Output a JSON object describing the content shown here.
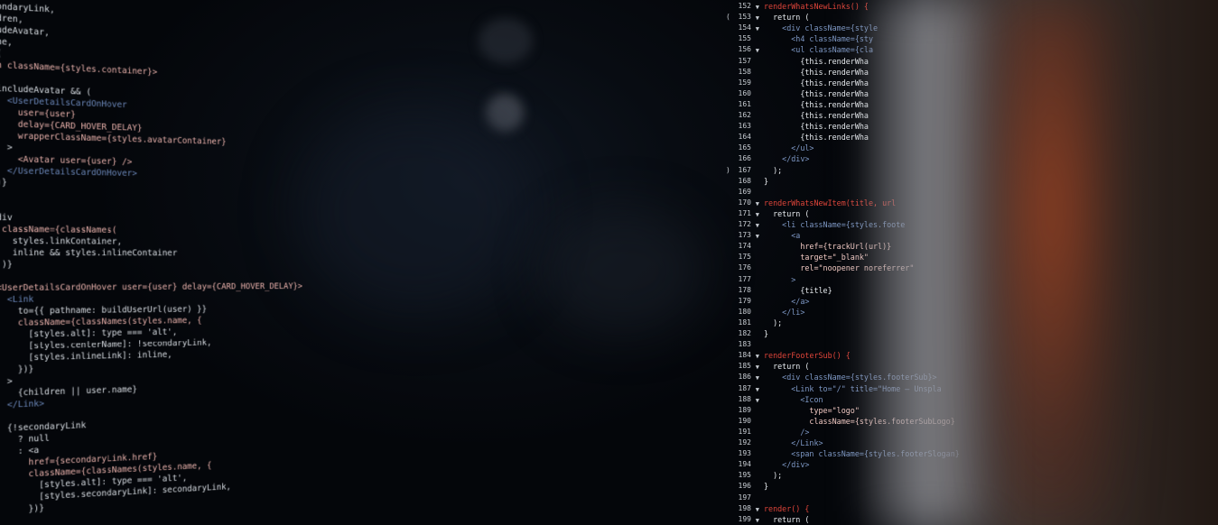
{
  "left_code": [
    {
      "t": "ondaryLink,"
    },
    {
      "t": "dren,"
    },
    {
      "t": "udeAvatar,"
    },
    {
      "t": "ne,"
    },
    {
      "t": "("
    },
    {
      "t": "n className={styles.container}>"
    },
    {
      "t": ""
    },
    {
      "t": "includeAvatar && ("
    },
    {
      "t": "  <UserDetailsCardOnHover"
    },
    {
      "t": "    user={user}"
    },
    {
      "t": "    delay={CARD_HOVER_DELAY}"
    },
    {
      "t": "    wrapperClassName={styles.avatarContainer}"
    },
    {
      "t": "  >"
    },
    {
      "t": "    <Avatar user={user} />"
    },
    {
      "t": "  </UserDetailsCardOnHover>"
    },
    {
      "t": ")}"
    },
    {
      "t": ""
    },
    {
      "t": ""
    },
    {
      "t": "div"
    },
    {
      "t": " className={classNames("
    },
    {
      "t": "   styles.linkContainer,"
    },
    {
      "t": "   inline && styles.inlineContainer"
    },
    {
      "t": " )}"
    },
    {
      "t": ""
    },
    {
      "t": "<UserDetailsCardOnHover user={user} delay={CARD_HOVER_DELAY}>"
    },
    {
      "t": "  <Link"
    },
    {
      "t": "    to={{ pathname: buildUserUrl(user) }}"
    },
    {
      "t": "    className={classNames(styles.name, {"
    },
    {
      "t": "      [styles.alt]: type === 'alt',"
    },
    {
      "t": "      [styles.centerName]: !secondaryLink,"
    },
    {
      "t": "      [styles.inlineLink]: inline,"
    },
    {
      "t": "    })}"
    },
    {
      "t": "  >"
    },
    {
      "t": "    {children || user.name}"
    },
    {
      "t": "  </Link>"
    },
    {
      "t": ""
    },
    {
      "t": "  {!secondaryLink"
    },
    {
      "t": "    ? null"
    },
    {
      "t": "    : <a"
    },
    {
      "t": "      href={secondaryLink.href}"
    },
    {
      "t": "      className={classNames(styles.name, {"
    },
    {
      "t": "        [styles.alt]: type === 'alt',"
    },
    {
      "t": "        [styles.secondaryLink]: secondaryLink,"
    },
    {
      "t": "      })}"
    }
  ],
  "right_gutter": [
    {
      "n": "152",
      "a": "▼"
    },
    {
      "n": "153",
      "a": "▼",
      "pre": "("
    },
    {
      "n": "154",
      "a": "▼"
    },
    {
      "n": "155",
      "a": ""
    },
    {
      "n": "156",
      "a": "▼"
    },
    {
      "n": "157",
      "a": ""
    },
    {
      "n": "158",
      "a": ""
    },
    {
      "n": "159",
      "a": ""
    },
    {
      "n": "160",
      "a": ""
    },
    {
      "n": "161",
      "a": ""
    },
    {
      "n": "162",
      "a": ""
    },
    {
      "n": "163",
      "a": ""
    },
    {
      "n": "164",
      "a": ""
    },
    {
      "n": "165",
      "a": ""
    },
    {
      "n": "166",
      "a": ""
    },
    {
      "n": "167",
      "a": "",
      "pre": ")"
    },
    {
      "n": "168",
      "a": ""
    },
    {
      "n": "169",
      "a": ""
    },
    {
      "n": "170",
      "a": "▼"
    },
    {
      "n": "171",
      "a": "▼"
    },
    {
      "n": "172",
      "a": "▼"
    },
    {
      "n": "173",
      "a": "▼"
    },
    {
      "n": "174",
      "a": ""
    },
    {
      "n": "175",
      "a": ""
    },
    {
      "n": "176",
      "a": ""
    },
    {
      "n": "177",
      "a": ""
    },
    {
      "n": "178",
      "a": ""
    },
    {
      "n": "179",
      "a": ""
    },
    {
      "n": "180",
      "a": ""
    },
    {
      "n": "181",
      "a": ""
    },
    {
      "n": "182",
      "a": ""
    },
    {
      "n": "183",
      "a": ""
    },
    {
      "n": "184",
      "a": "▼"
    },
    {
      "n": "185",
      "a": "▼"
    },
    {
      "n": "186",
      "a": "▼"
    },
    {
      "n": "187",
      "a": "▼"
    },
    {
      "n": "188",
      "a": "▼"
    },
    {
      "n": "189",
      "a": ""
    },
    {
      "n": "190",
      "a": ""
    },
    {
      "n": "191",
      "a": ""
    },
    {
      "n": "192",
      "a": ""
    },
    {
      "n": "193",
      "a": ""
    },
    {
      "n": "194",
      "a": ""
    },
    {
      "n": "195",
      "a": ""
    },
    {
      "n": "196",
      "a": ""
    },
    {
      "n": "197",
      "a": ""
    },
    {
      "n": "198",
      "a": "▼"
    },
    {
      "n": "199",
      "a": "▼"
    }
  ],
  "right_code": [
    {
      "t": "renderWhatsNewLinks() {"
    },
    {
      "t": "  return ("
    },
    {
      "t": "    <div className={style"
    },
    {
      "t": "      <h4 className={sty"
    },
    {
      "t": "      <ul className={cla"
    },
    {
      "t": "        {this.renderWha"
    },
    {
      "t": "        {this.renderWha"
    },
    {
      "t": "        {this.renderWha"
    },
    {
      "t": "        {this.renderWha"
    },
    {
      "t": "        {this.renderWha"
    },
    {
      "t": "        {this.renderWha"
    },
    {
      "t": "        {this.renderWha"
    },
    {
      "t": "        {this.renderWha"
    },
    {
      "t": "      </ul>"
    },
    {
      "t": "    </div>"
    },
    {
      "t": "  );"
    },
    {
      "t": "}"
    },
    {
      "t": ""
    },
    {
      "t": "renderWhatsNewItem(title, url"
    },
    {
      "t": "  return ("
    },
    {
      "t": "    <li className={styles.foote"
    },
    {
      "t": "      <a"
    },
    {
      "t": "        href={trackUrl(url)}"
    },
    {
      "t": "        target=\"_blank\""
    },
    {
      "t": "        rel=\"noopener noreferrer\""
    },
    {
      "t": "      >"
    },
    {
      "t": "        {title}"
    },
    {
      "t": "      </a>"
    },
    {
      "t": "    </li>"
    },
    {
      "t": "  );"
    },
    {
      "t": "}"
    },
    {
      "t": ""
    },
    {
      "t": "renderFooterSub() {"
    },
    {
      "t": "  return ("
    },
    {
      "t": "    <div className={styles.footerSub}>"
    },
    {
      "t": "      <Link to=\"/\" title=\"Home — Unspla"
    },
    {
      "t": "        <Icon"
    },
    {
      "t": "          type=\"logo\""
    },
    {
      "t": "          className={styles.footerSubLogo}"
    },
    {
      "t": "        />"
    },
    {
      "t": "      </Link>"
    },
    {
      "t": "      <span className={styles.footerSlogan}"
    },
    {
      "t": "    </div>"
    },
    {
      "t": "  );"
    },
    {
      "t": "}"
    },
    {
      "t": ""
    },
    {
      "t": "render() {"
    },
    {
      "t": "  return ("
    }
  ]
}
